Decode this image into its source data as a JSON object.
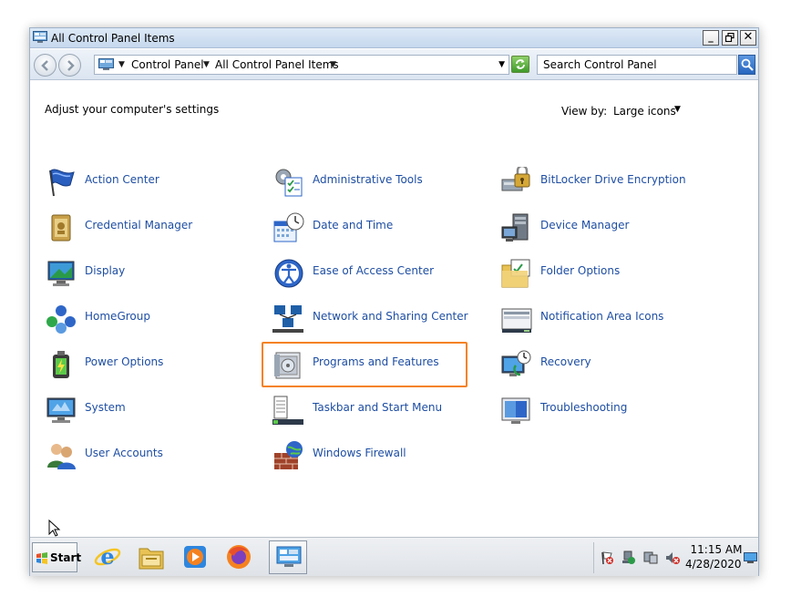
{
  "window": {
    "title": "All Control Panel Items"
  },
  "address": {
    "crumbs": [
      "Control Panel",
      "All Control Panel Items"
    ],
    "search_placeholder": "Search Control Panel"
  },
  "content": {
    "heading": "Adjust your computer's settings",
    "view_by_label": "View by:",
    "view_by_value": "Large icons"
  },
  "items": [
    {
      "label": "Action Center",
      "icon": "action-center-flag-icon"
    },
    {
      "label": "Administrative Tools",
      "icon": "administrative-tools-icon"
    },
    {
      "label": "BitLocker Drive Encryption",
      "icon": "bitlocker-icon"
    },
    {
      "label": "Credential Manager",
      "icon": "credential-manager-icon"
    },
    {
      "label": "Date and Time",
      "icon": "date-time-icon"
    },
    {
      "label": "Device Manager",
      "icon": "device-manager-icon"
    },
    {
      "label": "Display",
      "icon": "display-icon"
    },
    {
      "label": "Ease of Access Center",
      "icon": "ease-of-access-icon"
    },
    {
      "label": "Folder Options",
      "icon": "folder-options-icon"
    },
    {
      "label": "HomeGroup",
      "icon": "homegroup-icon"
    },
    {
      "label": "Network and Sharing Center",
      "icon": "network-sharing-icon"
    },
    {
      "label": "Notification Area Icons",
      "icon": "notification-area-icon"
    },
    {
      "label": "Power Options",
      "icon": "power-options-icon"
    },
    {
      "label": "Programs and Features",
      "icon": "programs-features-icon",
      "highlighted": true
    },
    {
      "label": "Recovery",
      "icon": "recovery-icon"
    },
    {
      "label": "System",
      "icon": "system-icon"
    },
    {
      "label": "Taskbar and Start Menu",
      "icon": "taskbar-start-menu-icon"
    },
    {
      "label": "Troubleshooting",
      "icon": "troubleshooting-icon"
    },
    {
      "label": "User Accounts",
      "icon": "user-accounts-icon"
    },
    {
      "label": "Windows Firewall",
      "icon": "windows-firewall-icon"
    }
  ],
  "taskbar": {
    "start_label": "Start",
    "apps": [
      "internet-explorer-icon",
      "windows-explorer-icon",
      "media-player-icon",
      "firefox-icon",
      "control-panel-icon"
    ],
    "tray_icons": [
      "action-center-tray-icon",
      "network-tray-icon",
      "display-tray-icon",
      "volume-muted-icon"
    ],
    "time": "11:15 AM",
    "date": "4/28/2020"
  },
  "colors": {
    "link": "#1e4ea3",
    "highlight": "#f5821f"
  }
}
